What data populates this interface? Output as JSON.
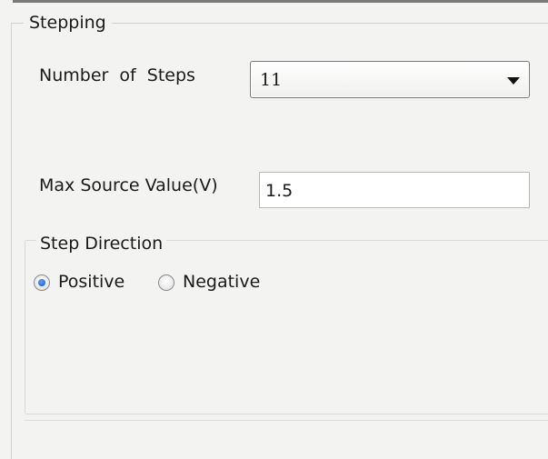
{
  "stepping": {
    "group_title": "Stepping",
    "number_of_steps_label": "Number  of  Steps",
    "number_of_steps_value": "11",
    "max_source_label": "Max Source Value(V)",
    "max_source_value": "1.5"
  },
  "step_direction": {
    "group_title": "Step Direction",
    "options": [
      {
        "label": "Positive",
        "selected": true
      },
      {
        "label": "Negative",
        "selected": false
      }
    ]
  },
  "colors": {
    "background": "#f3f3f1",
    "radio_selected": "#1750c8"
  }
}
